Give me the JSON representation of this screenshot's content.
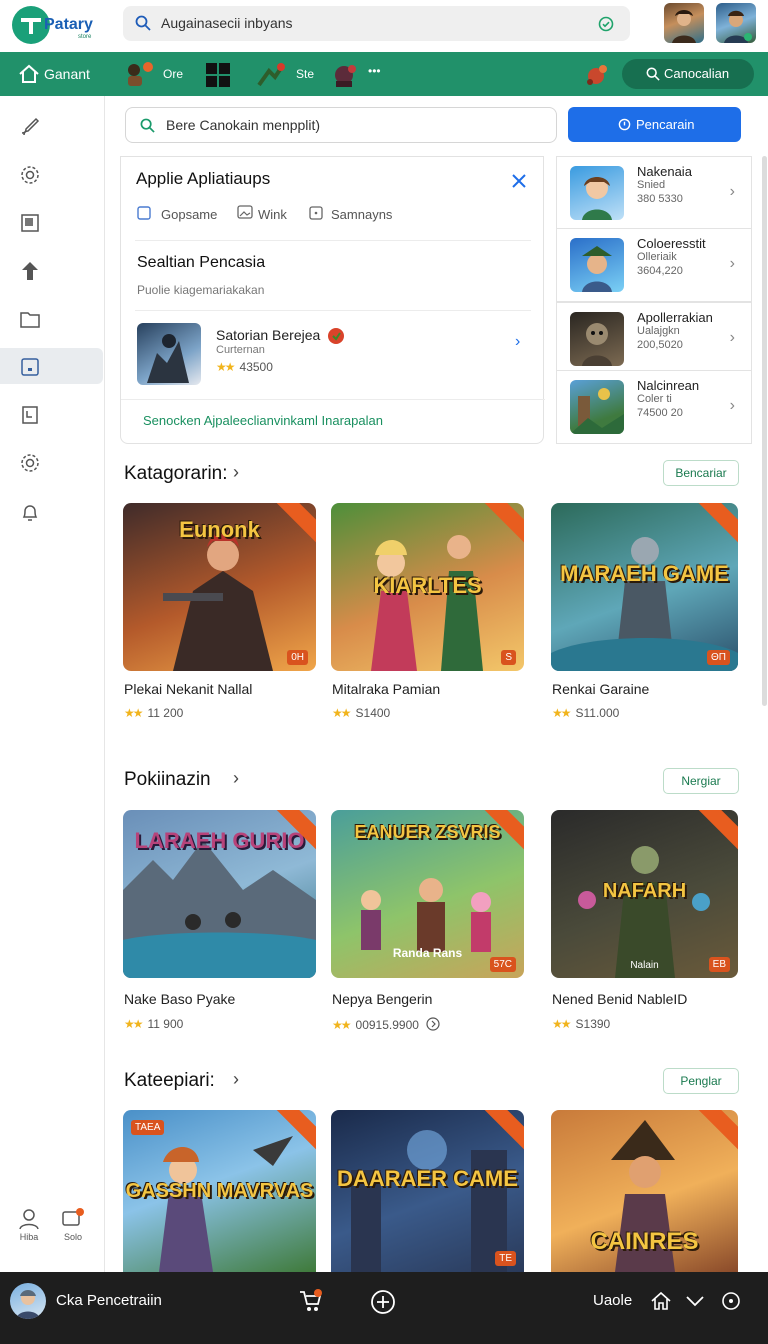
{
  "header": {
    "logo_text": "Patary",
    "logo_sub": "store",
    "search_text": "Augainasecii inbyans"
  },
  "nav": {
    "home_label": "Ganant",
    "item_2_label": "Ore",
    "item_4_label": "Ste",
    "more_label": "•••",
    "right_button_label": "Canocalian"
  },
  "sidebar": {
    "bottom_1_label": "Hiba",
    "bottom_2_label": "Solo",
    "badge": "1"
  },
  "search": {
    "placeholder": "Bere Canokain menpplit)",
    "button_label": "Pencarain"
  },
  "popup": {
    "title": "Applie Apliatiaups",
    "chips": [
      "Gopsame",
      "Wink",
      "Samnayns"
    ],
    "section_title": "Sealtian Pencasia",
    "section_sub": "Puolie kiagemariakakan",
    "result_name": "Satorian Berejea",
    "result_sub": "Curternan",
    "result_rating": "43500",
    "footer_link": "Senocken Ajpaleeclianvinkaml Inarapalan"
  },
  "right_list": [
    {
      "name": "Nakenaia",
      "line2": "Snied",
      "line3": "380 5330"
    },
    {
      "name": "Coloeresstit",
      "line2": "Olleriaik",
      "line3": "3604,220"
    },
    {
      "name": "Apollerrakian",
      "line2": "Ualajgkn",
      "line3": "200,5020"
    },
    {
      "name": "Nalcinrean",
      "line2": "Coler ti",
      "line3": "74500 20"
    }
  ],
  "sections": [
    {
      "title": "Katagorarin:",
      "button": "Bencariar",
      "cards": [
        {
          "art": "Eunonk",
          "pill": "0H",
          "name": "Plekai Nekanit Nallal",
          "rating": "11 200"
        },
        {
          "art": "KIARLTES",
          "pill": "S",
          "name": "Mitalraka Pamian",
          "rating": "S1400"
        },
        {
          "art": "MARAEH GAME",
          "pill": "ΘΠ",
          "name": "Renkai Garaine",
          "rating": "S11.000"
        }
      ]
    },
    {
      "title": "Pokiinazin",
      "button": "Nergiar",
      "cards": [
        {
          "art": "LARAEH GURIO",
          "pill": "",
          "name": "Nake Baso Pyake",
          "rating": "11 900"
        },
        {
          "art": "EANUER ZSVRIS",
          "pill": "57C",
          "name": "Nepya Bengerin",
          "rating": "00915.9900"
        },
        {
          "art": "NAFARH",
          "pill": "EB",
          "name": "Nened Benid NableID",
          "rating": "S1390"
        }
      ]
    },
    {
      "title": "Kateepiari:",
      "button": "Penglar",
      "cards": [
        {
          "art": "GASSHN MAVRVAS",
          "pill": "TAEA",
          "name": "",
          "rating": ""
        },
        {
          "art": "DAARAER CAME",
          "pill": "TE",
          "name": "",
          "rating": ""
        },
        {
          "art": "CAINRES",
          "pill": "",
          "name": "",
          "rating": ""
        }
      ]
    }
  ],
  "section2_card1_label": "Randa Rans",
  "section2_card3_label": "Nalain",
  "bottom": {
    "user_label": "Cka Pencetraiin",
    "cart_badge": "1",
    "right_label": "Uaole"
  },
  "colors": {
    "green": "#21916a",
    "blue": "#1e6ee8",
    "orange": "#e85d1f"
  }
}
